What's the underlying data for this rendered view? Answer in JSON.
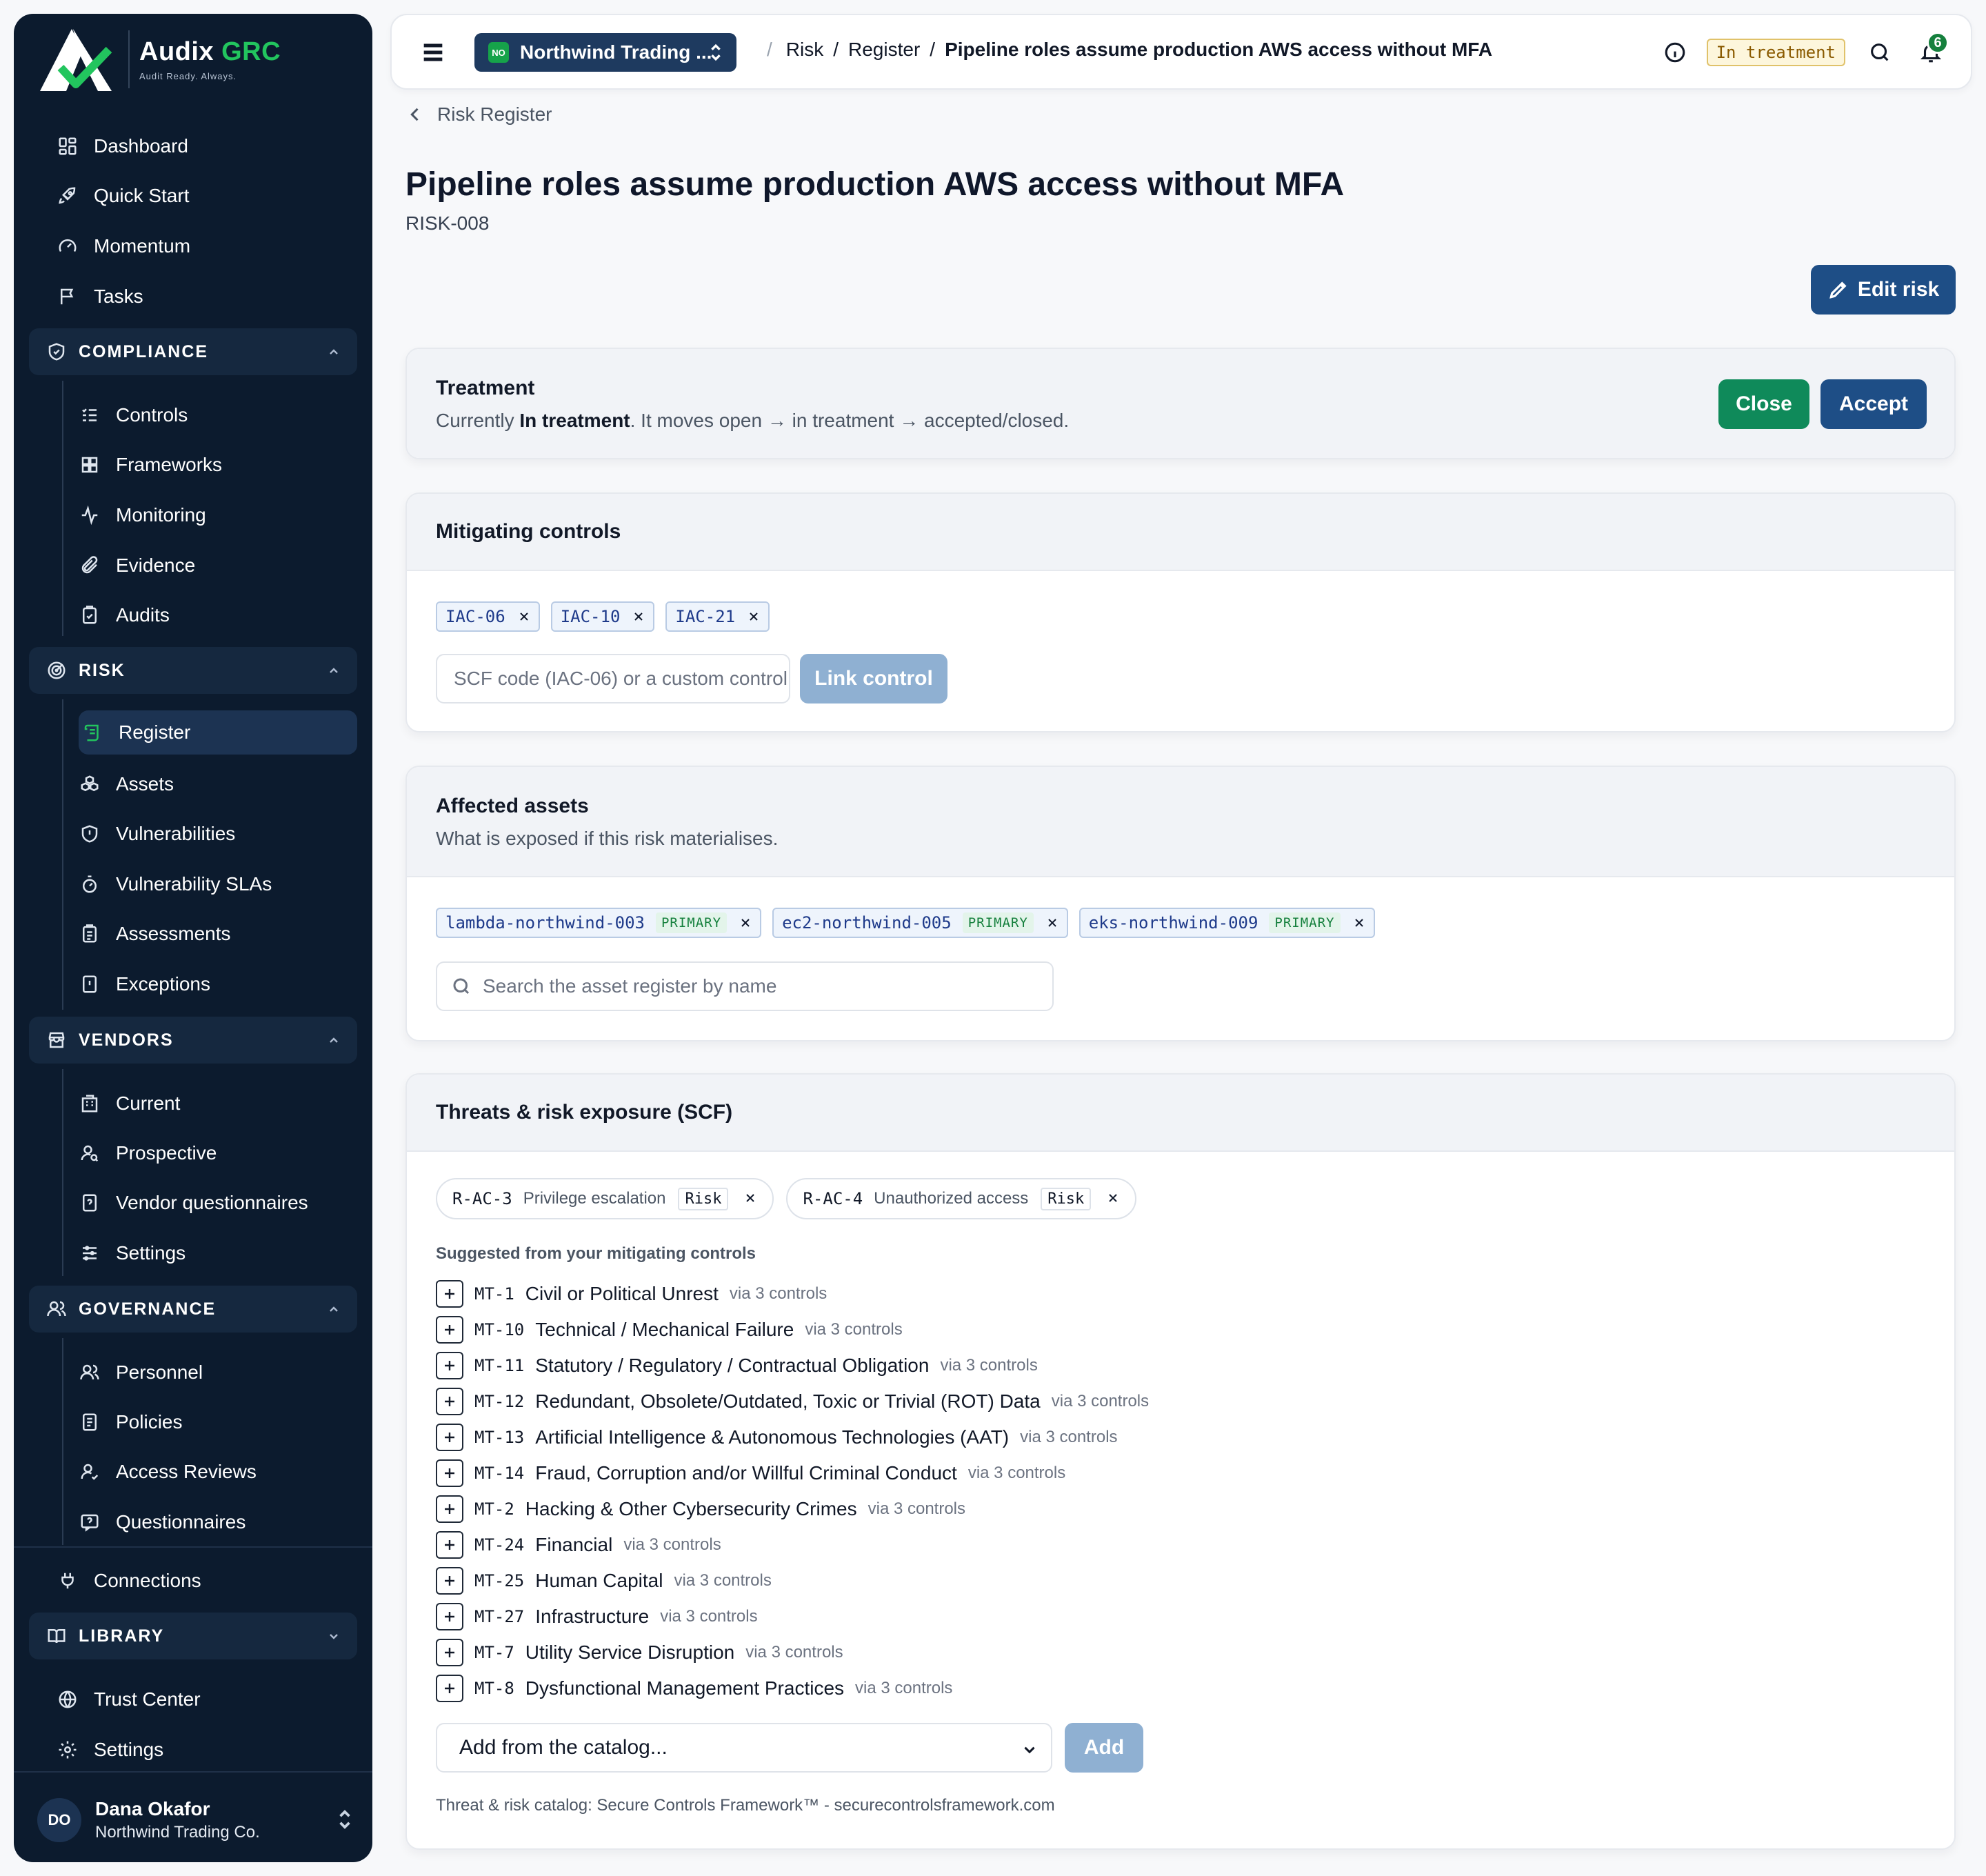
{
  "brand": {
    "name": "Audix",
    "name_accent": "GRC",
    "tagline": "Audit Ready. Always."
  },
  "sidebar": {
    "top_items": [
      {
        "label": "Dashboard",
        "icon": "dashboard-icon"
      },
      {
        "label": "Quick Start",
        "icon": "rocket-icon"
      },
      {
        "label": "Momentum",
        "icon": "gauge-icon"
      },
      {
        "label": "Tasks",
        "icon": "flag-icon"
      }
    ],
    "compliance": {
      "label": "COMPLIANCE",
      "items": [
        "Controls",
        "Frameworks",
        "Monitoring",
        "Evidence",
        "Audits"
      ]
    },
    "risk": {
      "label": "RISK",
      "items": [
        "Register",
        "Assets",
        "Vulnerabilities",
        "Vulnerability SLAs",
        "Assessments",
        "Exceptions"
      ],
      "active": "Register"
    },
    "vendors": {
      "label": "VENDORS",
      "items": [
        "Current",
        "Prospective",
        "Vendor questionnaires",
        "Settings"
      ]
    },
    "governance": {
      "label": "GOVERNANCE",
      "items": [
        "Personnel",
        "Policies",
        "Access Reviews",
        "Questionnaires"
      ]
    },
    "connections": "Connections",
    "library": {
      "label": "LIBRARY"
    },
    "bottom_items": [
      "Trust Center",
      "Settings"
    ],
    "user": {
      "initials": "DO",
      "name": "Dana Okafor",
      "org": "Northwind Trading Co."
    }
  },
  "topbar": {
    "org_badge": "NO",
    "org_name": "Northwind Trading ...",
    "breadcrumb": [
      "Risk",
      "Register",
      "Pipeline roles assume production AWS access without MFA"
    ],
    "status": "In treatment",
    "notifications": "6"
  },
  "page": {
    "back": "Risk Register",
    "title": "Pipeline roles assume production AWS access without MFA",
    "id": "RISK-008",
    "edit_label": "Edit risk"
  },
  "treatment": {
    "title": "Treatment",
    "sub_prefix": "Currently ",
    "sub_state": "In treatment",
    "sub_suffix": ". It moves open → in treatment → accepted/closed.",
    "close_label": "Close",
    "accept_label": "Accept"
  },
  "controls": {
    "title": "Mitigating controls",
    "chips": [
      "IAC-06",
      "IAC-10",
      "IAC-21"
    ],
    "placeholder": "SCF code (IAC-06) or a custom control",
    "link_label": "Link control"
  },
  "assets": {
    "title": "Affected assets",
    "subtitle": "What is exposed if this risk materialises.",
    "chips": [
      {
        "name": "lambda-northwind-003",
        "tag": "PRIMARY"
      },
      {
        "name": "ec2-northwind-005",
        "tag": "PRIMARY"
      },
      {
        "name": "eks-northwind-009",
        "tag": "PRIMARY"
      }
    ],
    "placeholder": "Search the asset register by name"
  },
  "threats": {
    "title": "Threats & risk exposure (SCF)",
    "chips": [
      {
        "code": "R-AC-3",
        "name": "Privilege escalation",
        "kind": "Risk"
      },
      {
        "code": "R-AC-4",
        "name": "Unauthorized access",
        "kind": "Risk"
      }
    ],
    "suggested_label": "Suggested from your mitigating controls",
    "suggested": [
      {
        "code": "MT-1",
        "name": "Civil or Political Unrest",
        "via": "via 3 controls"
      },
      {
        "code": "MT-10",
        "name": "Technical / Mechanical Failure",
        "via": "via 3 controls"
      },
      {
        "code": "MT-11",
        "name": "Statutory / Regulatory / Contractual Obligation",
        "via": "via 3 controls"
      },
      {
        "code": "MT-12",
        "name": "Redundant, Obsolete/Outdated, Toxic or Trivial (ROT) Data",
        "via": "via 3 controls"
      },
      {
        "code": "MT-13",
        "name": "Artificial Intelligence & Autonomous Technologies (AAT)",
        "via": "via 3 controls"
      },
      {
        "code": "MT-14",
        "name": "Fraud, Corruption and/or Willful Criminal Conduct",
        "via": "via 3 controls"
      },
      {
        "code": "MT-2",
        "name": "Hacking & Other Cybersecurity Crimes",
        "via": "via 3 controls"
      },
      {
        "code": "MT-24",
        "name": "Financial",
        "via": "via 3 controls"
      },
      {
        "code": "MT-25",
        "name": "Human Capital",
        "via": "via 3 controls"
      },
      {
        "code": "MT-27",
        "name": "Infrastructure",
        "via": "via 3 controls"
      },
      {
        "code": "MT-7",
        "name": "Utility Service Disruption",
        "via": "via 3 controls"
      },
      {
        "code": "MT-8",
        "name": "Dysfunctional Management Practices",
        "via": "via 3 controls"
      }
    ],
    "catalog_select": "Add from the catalog...",
    "add_label": "Add",
    "footnote": "Threat & risk catalog: Secure Controls Framework™ - securecontrolsframework.com"
  }
}
